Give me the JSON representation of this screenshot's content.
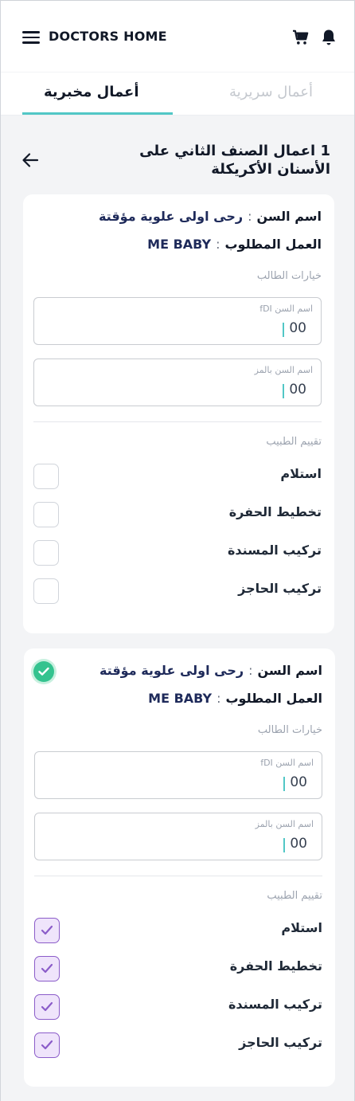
{
  "app": {
    "logo_text": "DOCTORS HOME",
    "accent_color": "#52c7c6",
    "check_color": "#8b5cc9",
    "done_color": "#34c38f"
  },
  "header": {
    "icons": [
      "menu-icon",
      "cart-icon",
      "bell-icon"
    ]
  },
  "tabs": [
    {
      "label": "أعمال سريرية",
      "active": false
    },
    {
      "label": "أعمال مخبرية",
      "active": true
    }
  ],
  "page": {
    "title": "1 اعمال الصنف الثاني على الأسنان الأكريكلة"
  },
  "labels": {
    "tooth_name": "اسم السن",
    "required_work": "العمل المطلوب",
    "student_options": "خيارات الطالب",
    "doctor_evaluation": "تقييم الطبيب",
    "fdi_label": "اسم السن fDI",
    "code_label": "اسم السن بالمز"
  },
  "cards": [
    {
      "tooth_value": "رحى اولى علوية مؤقتة",
      "work_value": "ME BABY",
      "fdi_value": "00",
      "code_value": "00",
      "done": false,
      "checklist": [
        {
          "label": "استلام",
          "checked": false
        },
        {
          "label": "تخطيط الحفرة",
          "checked": false
        },
        {
          "label": "تركيب المسندة",
          "checked": false
        },
        {
          "label": "تركيب الحاجز",
          "checked": false
        }
      ]
    },
    {
      "tooth_value": "رحى اولى علوية مؤقتة",
      "work_value": "ME BABY",
      "fdi_value": "00",
      "code_value": "00",
      "done": true,
      "checklist": [
        {
          "label": "استلام",
          "checked": true
        },
        {
          "label": "تخطيط الحفرة",
          "checked": true
        },
        {
          "label": "تركيب المسندة",
          "checked": true
        },
        {
          "label": "تركيب الحاجز",
          "checked": true
        }
      ]
    }
  ]
}
